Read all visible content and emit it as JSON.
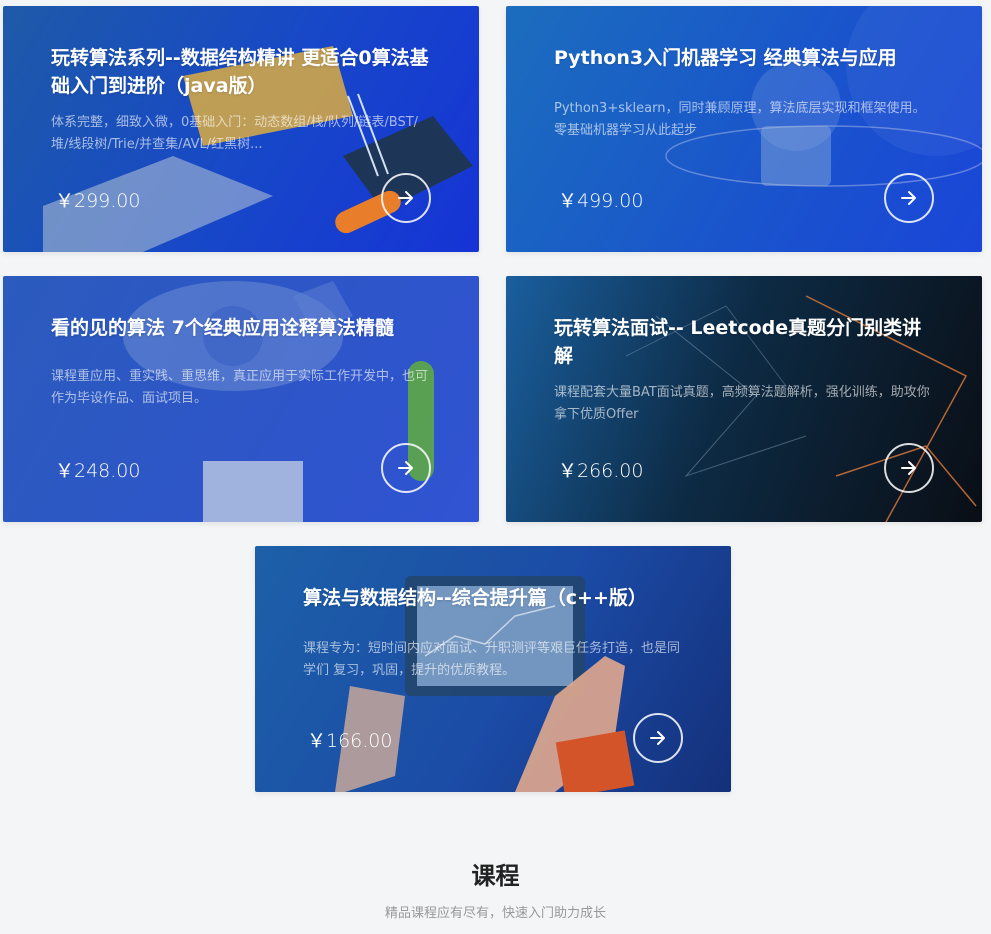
{
  "cards": [
    {
      "title": "玩转算法系列--数据结构精讲 更适合0算法基础入门到进阶（java版）",
      "desc": "体系完整，细致入微，0基础入门：动态数组/栈/队列/链表/BST/堆/线段树/Trie/并查集/AVL/红黑树...",
      "price": "￥299.00"
    },
    {
      "title": "Python3入门机器学习 经典算法与应用",
      "desc": "Python3+sklearn，同时兼顾原理，算法底层实现和框架使用。零基础机器学习从此起步",
      "price": "￥499.00"
    },
    {
      "title": "看的见的算法 7个经典应用诠释算法精髓",
      "desc": "课程重应用、重实践、重思维，真正应用于实际工作开发中，也可作为毕设作品、面试项目。",
      "price": "￥248.00"
    },
    {
      "title": "玩转算法面试-- Leetcode真题分门别类讲解",
      "desc": "课程配套大量BAT面试真题，高频算法题解析，强化训练，助攻你拿下优质Offer",
      "price": "￥266.00"
    },
    {
      "title": "算法与数据结构--综合提升篇（c++版）",
      "desc": "课程专为：短时间内应对面试、升职测评等艰巨任务打造，也是同学们 复习，巩固，提升的优质教程。",
      "price": "￥166.00"
    }
  ],
  "section": {
    "title": "课程",
    "subtitle": "精品课程应有尽有，快速入门助力成长"
  },
  "icons": {
    "arrow": "arrow-right-icon"
  }
}
